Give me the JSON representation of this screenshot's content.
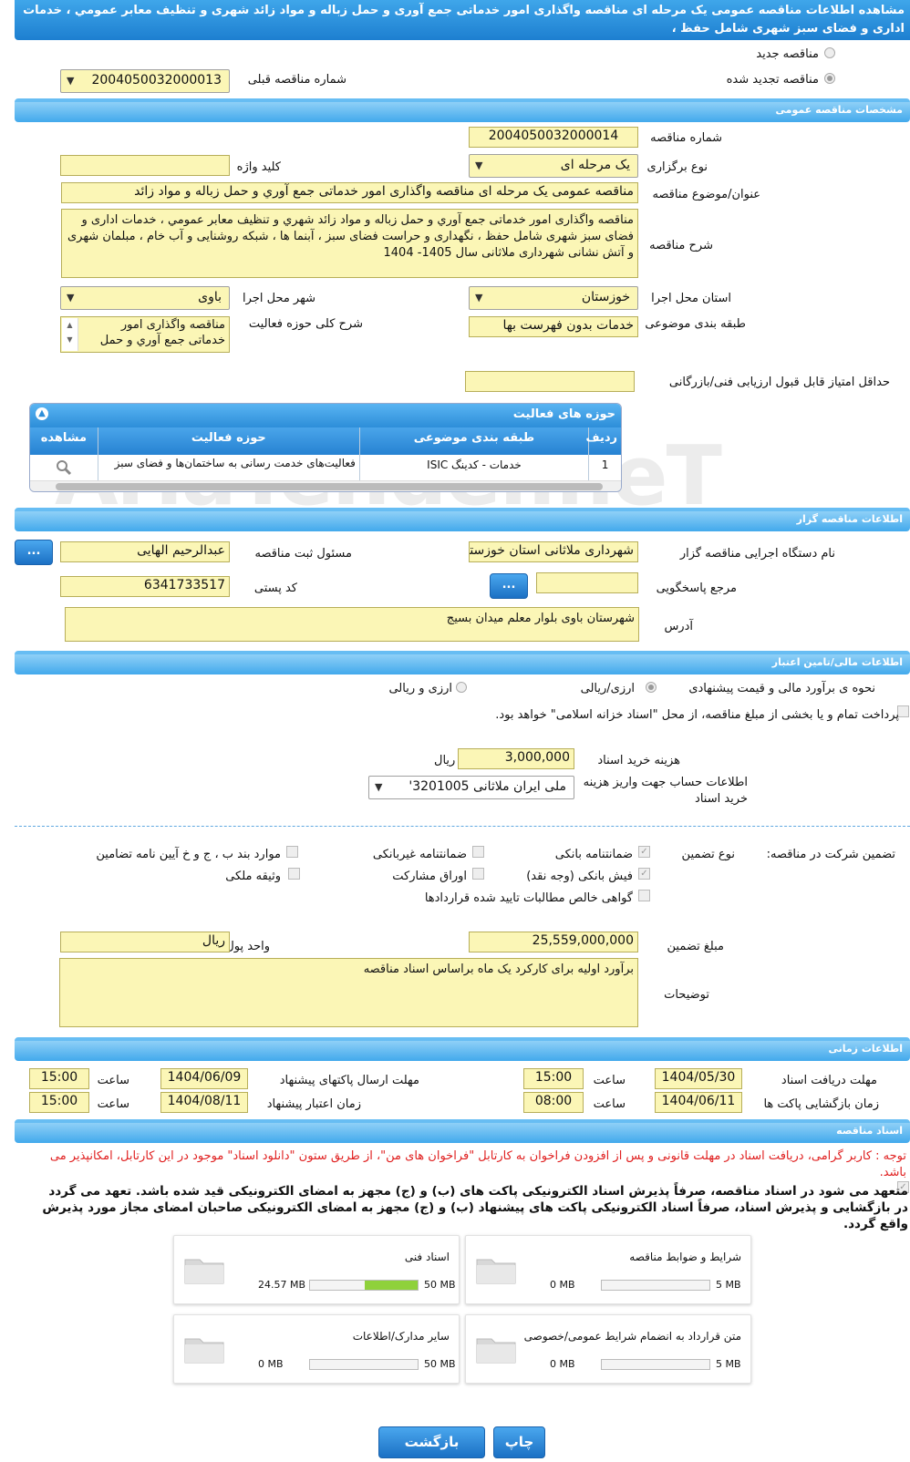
{
  "title": "مشاهده اطلاعات مناقصه عمومی یک مرحله ای مناقصه واگذاری امور خدماتی جمع آوری و حمل زباله و مواد زائد شهری و تنظیف معابر عمومي ، خدمات اداری و فضای سبز شهری شامل حفظ ،",
  "tender_type": {
    "new_label": "مناقصه جدید",
    "renewed_label": "مناقصه تجدید شده",
    "prev_number_label": "شماره مناقصه قبلی",
    "prev_number": "2004050032000013"
  },
  "general": {
    "section": "مشخصات مناقصه عمومی",
    "number_label": "شماره مناقصه",
    "number": "2004050032000014",
    "type_label": "نوع برگزاری",
    "type": "یک مرحله ای",
    "keyword_label": "کلید واژه",
    "keyword": "",
    "subject_label": "عنوان/موضوع مناقصه",
    "subject": "مناقصه عمومی یک مرحله ای مناقصه واگذاری امور خدماتی جمع آوري و حمل زباله و مواد زائد",
    "desc_label": "شرح مناقصه",
    "desc": "مناقصه واگذاری امور خدماتی جمع آوري و حمل زباله و مواد زائد شهري و تنظیف معابر عمومي ، خدمات اداری و فضای سبز شهری شامل حفظ ، نگهداری  و حراست فضای سبز ، آبنما ها ، شبکه روشنایی و آب خام ، مبلمان شهری و آتش نشانی شهرداری ملاثانی سال 1405- 1404",
    "province_label": "استان محل اجرا",
    "province": "خوزستان",
    "city_label": "شهر محل اجرا",
    "city": "باوی",
    "category_label": "طبقه بندی موضوعی",
    "category": "خدمات بدون فهرست بها",
    "scope_label": "شرح کلی حوزه فعالیت",
    "scope": "مناقصه واگذاری امور خدماتی جمع آوري و حمل",
    "min_score_label": "حداقل امتیاز قابل قبول ارزیابی فنی/بازرگانی",
    "min_score": ""
  },
  "activity": {
    "title": "حوزه های فعالیت",
    "cols": [
      "ردیف",
      "طبقه بندی موضوعی",
      "حوزه فعالیت",
      "مشاهده"
    ],
    "rows": [
      {
        "n": "1",
        "cat": "خدمات - کدینگ ISIC",
        "area": "فعالیت‌های خدمت رسانی به ساختمان‌ها و فضای سبز"
      }
    ]
  },
  "organizer": {
    "section": "اطلاعات مناقصه گزار",
    "org_label": "نام دستگاه اجرایی مناقصه گزار",
    "org": "شهرداری ملاثانی استان خوزستان",
    "resp_label": "مسئول ثبت مناقصه",
    "resp": "عبدالرحیم الهایی",
    "ref_label": "مرجع پاسخگویی",
    "ref": "",
    "postal_label": "کد پستی",
    "postal": "6341733517",
    "addr_label": "آدرس",
    "addr": "شهرستان باوی بلوار معلم میدان بسیج",
    "btn": "..."
  },
  "finance": {
    "section": "اطلاعات مالی/تامین اعتبار",
    "estimate_label": "نحوه ی برآورد مالی و قیمت پیشنهادی",
    "opt1": "ارزی/ریالی",
    "opt2": "ارزی و ریالی",
    "treasury": "پرداخت تمام و یا بخشی از مبلغ مناقصه، از محل \"اسناد خزانه اسلامی\" خواهد بود.",
    "doc_cost_label": "هزینه خرید اسناد",
    "doc_cost": "3,000,000",
    "rial": "ریال",
    "account_label": "اطلاعات حساب جهت واریز هزینه خرید اسناد",
    "account": "ملی ایران ملاثانی 3201005'"
  },
  "guarantee": {
    "label": "تضمین شرکت در مناقصه:",
    "type_label": "نوع تضمین",
    "items": [
      "ضمانتنامه بانکی",
      "ضمانتنامه غیربانکی",
      "موارد بند ب ، ج و خ آیین نامه تضامین",
      "فیش بانکی (وجه نقد)",
      "اوراق مشارکت",
      "وثیقه ملکی",
      "گواهی خالص مطالبات تایید شده قراردادها"
    ],
    "amount_label": "مبلغ تضمین",
    "amount": "25,559,000,000",
    "currency_label": "واحد پول",
    "currency": "ریال",
    "notes_label": "توضیحات",
    "notes": "برآورد اولیه برای کارکرد یک ماه براساس اسناد مناقصه"
  },
  "timing": {
    "section": "اطلاعات زمانی",
    "doc_deadline_label": "مهلت دریافت اسناد",
    "doc_deadline": "1404/05/30",
    "doc_time": "15:00",
    "submit_deadline_label": "مهلت ارسال پاکتهای پیشنهاد",
    "submit_deadline": "1404/06/09",
    "submit_time": "15:00",
    "open_label": "زمان بازگشایی پاکت ها",
    "open": "1404/06/11",
    "open_time": "08:00",
    "valid_label": "زمان اعتبار پیشنهاد",
    "valid": "1404/08/11",
    "valid_time": "15:00",
    "time_label": "ساعت"
  },
  "docs": {
    "section": "اسناد مناقصه",
    "note": "توجه : کاربر گرامی، دریافت اسناد در مهلت قانونی و پس از افزودن فراخوان به کارتابل \"فراخوان های من\"، از طریق ستون \"دانلود اسناد\" موجود در این کارتابل، امکانپذیر می باشد.",
    "commit": "متعهد می شود در اسناد مناقصه، صرفاً پذیرش اسناد الکترونیکی پاکت های (ب) و (ج) مجهز به امضای الکترونیکی قید شده باشد. تعهد می گردد در بازگشایی و پذیرش اسناد، صرفاً اسناد الکترونیکی پاکت های پیشنهاد (ب) و (ج) مجهز به امضای الکترونیکی صاحبان امضای مجاز مورد پذیرش واقع گردد.",
    "boxes": [
      {
        "title": "شرایط و ضوابط مناقصه",
        "used": "0 MB",
        "max": "5 MB",
        "fill": 0
      },
      {
        "title": "اسناد فنی",
        "used": "24.57 MB",
        "max": "50 MB",
        "fill": 0.49
      },
      {
        "title": "متن قرارداد به انضمام شرایط عمومی/خصوصی",
        "used": "0 MB",
        "max": "5 MB",
        "fill": 0
      },
      {
        "title": "سایر مدارک/اطلاعات",
        "used": "0 MB",
        "max": "50 MB",
        "fill": 0
      }
    ]
  },
  "buttons": {
    "back": "بازگشت",
    "print": "چاپ"
  },
  "watermark": "AriaTender.neT"
}
